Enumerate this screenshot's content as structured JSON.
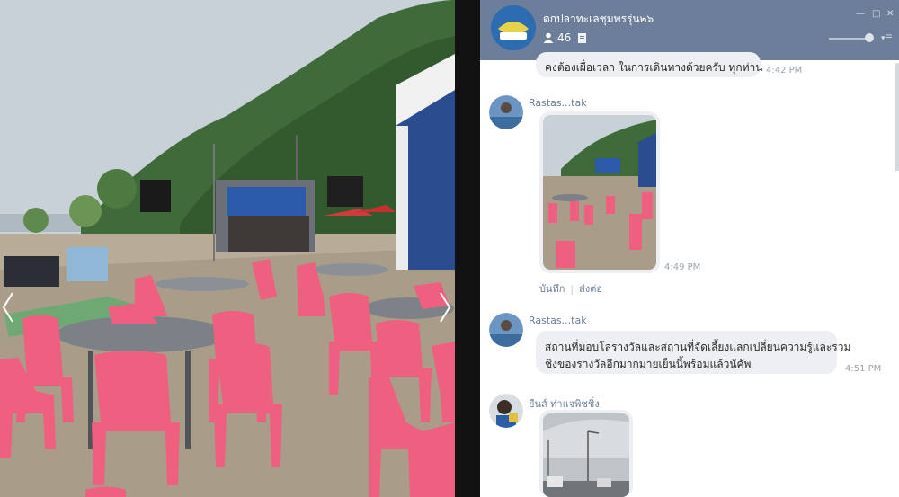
{
  "chat": {
    "group_name": "ดกปลาทะเลชุมพรรุ่น๒๖",
    "member_count": "46",
    "messages": [
      {
        "text": "คงต้องเผื่อเวลา  ในการเดินทางด้วยครับ  ทุกท่าน",
        "time": "4:42 PM"
      },
      {
        "sender": "Rastas...tak",
        "time": "4:49 PM"
      },
      {
        "sender": "Rastas...tak",
        "text_line1": "สถานที่มอบโล่รางวัลและสถานที่จัดเลี้ยงแลกเปลี่ยนความรู้และรวม",
        "text_line2": "ชิงของรางวัลอีกมากมายเย็นนี้พร้อมแล้วนัคัพ",
        "time": "4:51 PM"
      },
      {
        "sender": "ยืนส์ ท่าแจพิชชิ่ง"
      }
    ],
    "actions": {
      "save": "บันทึก",
      "share": "ส่งต่อ"
    }
  },
  "icons": {
    "members": "person-icon",
    "note": "note-icon",
    "prev": "chevron-left-icon",
    "next": "chevron-right-icon"
  },
  "colors": {
    "header_bg": "#6d7e9a",
    "bubble_bg": "#edeff2",
    "sender_text": "#6a7d98",
    "time_text": "#9aa3ad",
    "chair_pink": "#ef5f7f"
  }
}
